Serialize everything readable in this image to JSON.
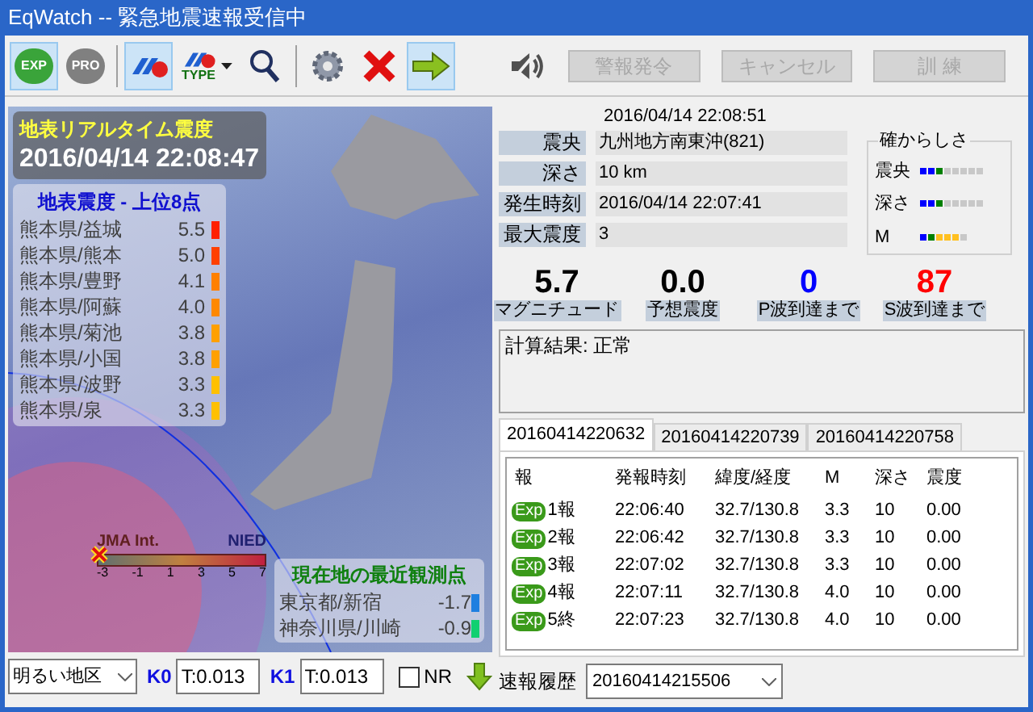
{
  "window": {
    "title": "EqWatch -- 緊急地震速報受信中"
  },
  "toolbar": {
    "tools": [
      {
        "kind": "exp",
        "label": "EXP",
        "selected": true
      },
      {
        "kind": "pro",
        "label": "PRO",
        "selected": false
      },
      {
        "kind": "logo",
        "selected": true
      },
      {
        "kind": "type",
        "label": "TYPE",
        "selected": false
      },
      {
        "kind": "search",
        "selected": false
      },
      {
        "kind": "gear",
        "selected": false
      },
      {
        "kind": "close",
        "selected": false
      },
      {
        "kind": "arrow",
        "selected": true
      }
    ],
    "sound_muted": true,
    "buttons": [
      {
        "label": "警報発令",
        "disabled": true
      },
      {
        "label": "キャンセル",
        "disabled": true
      },
      {
        "label": "訓 練",
        "disabled": true
      }
    ]
  },
  "map": {
    "title": "地表リアルタイム震度",
    "time": "2016/04/14 22:08:47",
    "ranking": {
      "title": "地表震度 - 上位8点",
      "items": [
        {
          "place": "熊本県/益城",
          "value": "5.5",
          "color": "#ff2000"
        },
        {
          "place": "熊本県/熊本",
          "value": "5.0",
          "color": "#ff4000"
        },
        {
          "place": "熊本県/豊野",
          "value": "4.1",
          "color": "#ff8000"
        },
        {
          "place": "熊本県/阿蘇",
          "value": "4.0",
          "color": "#ff8800"
        },
        {
          "place": "熊本県/菊池",
          "value": "3.8",
          "color": "#ffa000"
        },
        {
          "place": "熊本県/小国",
          "value": "3.8",
          "color": "#ffa000"
        },
        {
          "place": "熊本県/波野",
          "value": "3.3",
          "color": "#ffc000"
        },
        {
          "place": "熊本県/泉",
          "value": "3.3",
          "color": "#ffc000"
        }
      ]
    },
    "scale": {
      "title": "JMA Int.",
      "source": "NIED",
      "ticks": [
        "-3",
        "-1",
        "1",
        "3",
        "5",
        "7"
      ]
    },
    "nearest": {
      "title": "現在地の最近観測点",
      "items": [
        {
          "place": "東京都/新宿",
          "value": "-1.7",
          "color": "#1e7fe0"
        },
        {
          "place": "神奈川県/川崎",
          "value": "-0.9",
          "color": "#10d070"
        }
      ]
    }
  },
  "controls": {
    "map_style": "明るい地区",
    "k0_label": "K0",
    "k0": "T:0.013",
    "k1_label": "K1",
    "k1": "T:0.013",
    "nr_label": "NR",
    "nr_checked": false
  },
  "info": {
    "updated": "2016/04/14 22:08:51",
    "fields": [
      {
        "label": "震央",
        "value": "九州地方南東沖(821)"
      },
      {
        "label": "深さ",
        "value": "10 km"
      },
      {
        "label": "発生時刻",
        "value": "2016/04/14 22:07:41"
      },
      {
        "label": "最大震度",
        "value": "3"
      }
    ],
    "confidence": {
      "title": "確からしさ",
      "rows": [
        {
          "label": "震央",
          "cells": [
            {
              "color": "#0000ff"
            },
            {
              "color": "#0000ff"
            },
            {
              "color": "#008000"
            },
            {
              "color": "#c8c8c8"
            },
            {
              "color": "#c8c8c8"
            },
            {
              "color": "#c8c8c8"
            },
            {
              "color": "#c8c8c8"
            },
            {
              "color": "#c8c8c8"
            }
          ]
        },
        {
          "label": "深さ",
          "cells": [
            {
              "color": "#0000ff"
            },
            {
              "color": "#0000ff"
            },
            {
              "color": "#008000"
            },
            {
              "color": "#c8c8c8"
            },
            {
              "color": "#c8c8c8"
            },
            {
              "color": "#c8c8c8"
            },
            {
              "color": "#c8c8c8"
            },
            {
              "color": "#c8c8c8"
            }
          ]
        },
        {
          "label": "M",
          "cells": [
            {
              "color": "#0000ff"
            },
            {
              "color": "#008000"
            },
            {
              "color": "#ffc020"
            },
            {
              "color": "#ffc020"
            },
            {
              "color": "#ffc020"
            },
            {
              "color": "#c8c8c8"
            }
          ]
        }
      ]
    },
    "metrics": [
      {
        "value": "5.7",
        "label": "マグニチュード",
        "color": "#000000"
      },
      {
        "value": "0.0",
        "label": "予想震度",
        "color": "#000000"
      },
      {
        "value": "0",
        "label": "P波到達まで",
        "color": "#0000ff"
      },
      {
        "value": "87",
        "label": "S波到達まで",
        "color": "#ff0000"
      }
    ],
    "result": "計算結果: 正常"
  },
  "tabs": [
    {
      "label": "20160414220632",
      "selected": true
    },
    {
      "label": "20160414220739",
      "selected": false
    },
    {
      "label": "20160414220758",
      "selected": false
    }
  ],
  "table": {
    "columns": [
      "報",
      "発報時刻",
      "緯度/経度",
      "M",
      "深さ",
      "震度"
    ],
    "rows": [
      {
        "badge": "Exp",
        "report": "1報",
        "time": "22:06:40",
        "latlon": "32.7/130.8",
        "m": "3.3",
        "depth": "10",
        "intensity": "0.00"
      },
      {
        "badge": "Exp",
        "report": "2報",
        "time": "22:06:42",
        "latlon": "32.7/130.8",
        "m": "3.3",
        "depth": "10",
        "intensity": "0.00"
      },
      {
        "badge": "Exp",
        "report": "3報",
        "time": "22:07:02",
        "latlon": "32.7/130.8",
        "m": "3.3",
        "depth": "10",
        "intensity": "0.00"
      },
      {
        "badge": "Exp",
        "report": "4報",
        "time": "22:07:11",
        "latlon": "32.7/130.8",
        "m": "4.0",
        "depth": "10",
        "intensity": "0.00"
      },
      {
        "badge": "Exp",
        "report": "5終",
        "time": "22:07:23",
        "latlon": "32.7/130.8",
        "m": "4.0",
        "depth": "10",
        "intensity": "0.00"
      }
    ]
  },
  "history": {
    "label": "速報履歴",
    "value": "20160414215506"
  }
}
